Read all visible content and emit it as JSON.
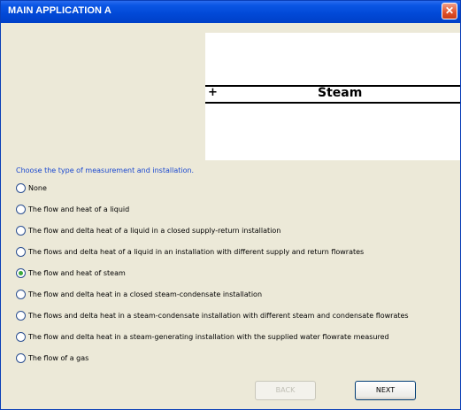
{
  "window": {
    "title": "MAIN APPLICATION A",
    "close_glyph": "✕"
  },
  "preview": {
    "plus_glyph": "+",
    "medium_label": "Steam"
  },
  "prompt": "Choose the type of measurement and installation.",
  "options": [
    {
      "label": "None",
      "checked": false
    },
    {
      "label": "The flow and heat of a liquid",
      "checked": false
    },
    {
      "label": "The flow and delta heat of a liquid in a closed supply-return installation",
      "checked": false
    },
    {
      "label": "The flows and delta heat of a liquid in an installation with different supply and return flowrates",
      "checked": false
    },
    {
      "label": "The flow and heat of steam",
      "checked": true
    },
    {
      "label": "The flow and delta heat in a closed steam-condensate installation",
      "checked": false
    },
    {
      "label": "The flows and delta heat in a steam-condensate installation with different steam and condensate flowrates",
      "checked": false
    },
    {
      "label": "The flow and delta heat in a steam-generating installation with the supplied water flowrate measured",
      "checked": false
    },
    {
      "label": "The flow of a gas",
      "checked": false
    }
  ],
  "buttons": {
    "back_label": "BACK",
    "next_label": "NEXT"
  },
  "colors": {
    "titlebar": "#0148d6",
    "prompt_text": "#1a48d0",
    "selected_radio": "#3aa83a",
    "close_button": "#e0502a"
  }
}
